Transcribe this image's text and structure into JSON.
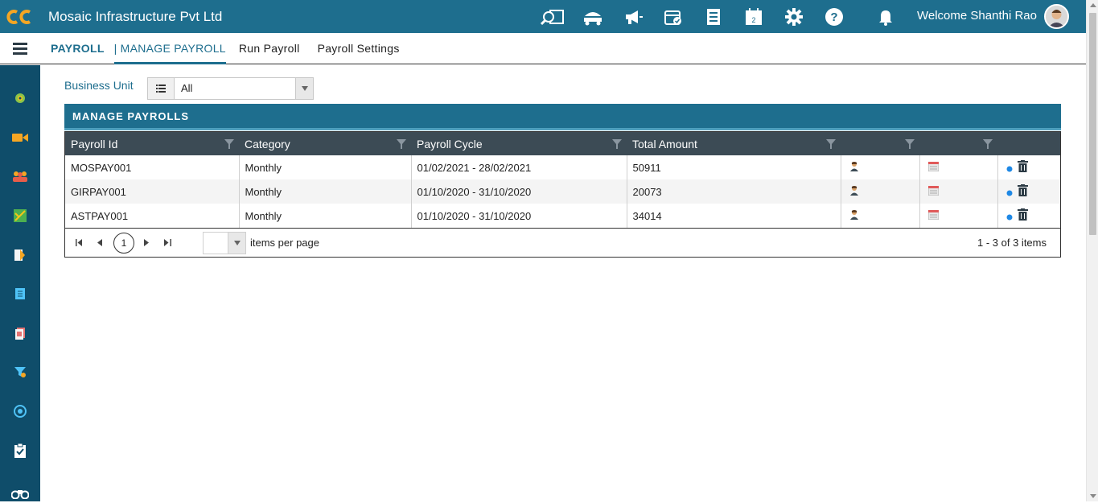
{
  "app": {
    "title": "Mosaic Infrastructure Pvt Ltd",
    "welcome": "Welcome Shanthi Rao"
  },
  "topnav_icons": [
    "search-report-icon",
    "truck-icon",
    "megaphone-icon",
    "calendar-check-icon",
    "checklist-icon",
    "calendar-icon",
    "gear-icon",
    "help-icon",
    "bell-icon"
  ],
  "subnav": {
    "section": "PAYROLL",
    "separator": "|",
    "current": "MANAGE PAYROLL",
    "links": [
      "Run Payroll",
      "Payroll Settings"
    ]
  },
  "sidebar_icons": [
    "settings-cog-icon",
    "video-icon",
    "team-icon",
    "map-icon",
    "document-icon",
    "notebook-icon",
    "file-icon",
    "filter-icon",
    "target-icon",
    "clipboard-check-icon",
    "binoculars-icon"
  ],
  "filter": {
    "label": "Business Unit",
    "value": "All"
  },
  "panel": {
    "title": "MANAGE PAYROLLS"
  },
  "table": {
    "columns": [
      "Payroll Id",
      "Category",
      "Payroll Cycle",
      "Total Amount",
      "",
      "",
      ""
    ],
    "rows": [
      {
        "id": "MOSPAY001",
        "category": "Monthly",
        "cycle": "01/02/2021 - 28/02/2021",
        "amount": "50911"
      },
      {
        "id": "GIRPAY001",
        "category": "Monthly",
        "cycle": "01/10/2020 - 31/10/2020",
        "amount": "20073"
      },
      {
        "id": "ASTPAY001",
        "category": "Monthly",
        "cycle": "01/10/2020 - 31/10/2020",
        "amount": "34014"
      }
    ]
  },
  "pager": {
    "page": "1",
    "per_page_label": "items per page",
    "info": "1 - 3 of 3 items"
  },
  "colors": {
    "primary": "#1e6e8e",
    "sidebar": "#0f4d6a",
    "header_row": "#3c4b55"
  }
}
